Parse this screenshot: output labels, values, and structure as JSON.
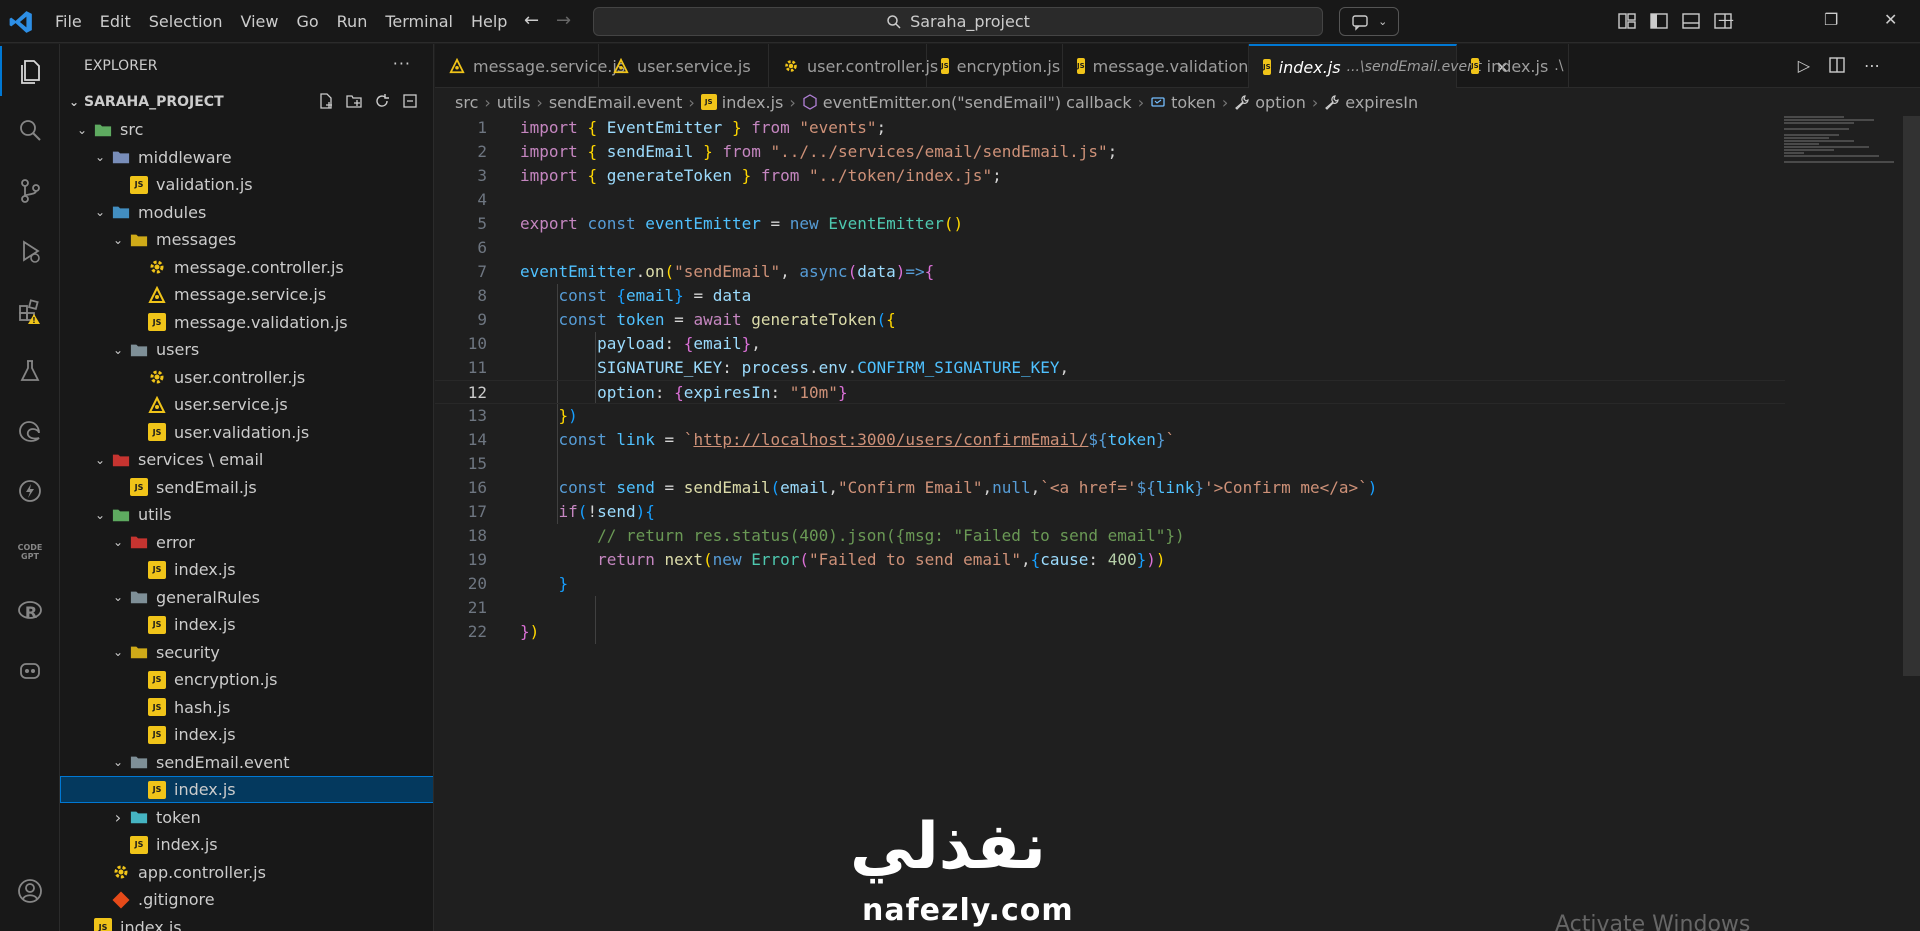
{
  "title_bar": {
    "menu": [
      "File",
      "Edit",
      "Selection",
      "View",
      "Go",
      "Run",
      "Terminal",
      "Help"
    ],
    "search_text": "Saraha_project"
  },
  "explorer": {
    "header": "EXPLORER",
    "more": "···",
    "project": "SARAHA_PROJECT",
    "tree": [
      {
        "label": "src",
        "depth": 0,
        "type": "folder",
        "open": true,
        "color": "#6bc46d"
      },
      {
        "label": "middleware",
        "depth": 1,
        "type": "folder",
        "open": true,
        "color": "#8aa2d6"
      },
      {
        "label": "validation.js",
        "depth": 2,
        "type": "js"
      },
      {
        "label": "modules",
        "depth": 1,
        "type": "folder",
        "open": true,
        "color": "#4aa3df"
      },
      {
        "label": "messages",
        "depth": 2,
        "type": "folder",
        "open": true,
        "color": "#f0c419"
      },
      {
        "label": "message.controller.js",
        "depth": 3,
        "type": "gear"
      },
      {
        "label": "message.service.js",
        "depth": 3,
        "type": "service"
      },
      {
        "label": "message.validation.js",
        "depth": 3,
        "type": "js"
      },
      {
        "label": "users",
        "depth": 2,
        "type": "folder",
        "open": true,
        "color": "#90a4ae"
      },
      {
        "label": "user.controller.js",
        "depth": 3,
        "type": "gear"
      },
      {
        "label": "user.service.js",
        "depth": 3,
        "type": "service"
      },
      {
        "label": "user.validation.js",
        "depth": 3,
        "type": "js"
      },
      {
        "label": "services \\ email",
        "depth": 1,
        "type": "folder",
        "open": true,
        "color": "#e53935"
      },
      {
        "label": "sendEmail.js",
        "depth": 2,
        "type": "js"
      },
      {
        "label": "utils",
        "depth": 1,
        "type": "folder",
        "open": true,
        "color": "#6bc46d"
      },
      {
        "label": "error",
        "depth": 2,
        "type": "folder",
        "open": true,
        "color": "#e53935"
      },
      {
        "label": "index.js",
        "depth": 3,
        "type": "js"
      },
      {
        "label": "generalRules",
        "depth": 2,
        "type": "folder",
        "open": true,
        "color": "#90a4ae"
      },
      {
        "label": "index.js",
        "depth": 3,
        "type": "js"
      },
      {
        "label": "security",
        "depth": 2,
        "type": "folder",
        "open": true,
        "color": "#f0c419"
      },
      {
        "label": "encryption.js",
        "depth": 3,
        "type": "js"
      },
      {
        "label": "hash.js",
        "depth": 3,
        "type": "js"
      },
      {
        "label": "index.js",
        "depth": 3,
        "type": "js"
      },
      {
        "label": "sendEmail.event",
        "depth": 2,
        "type": "folder",
        "open": true,
        "color": "#90a4ae"
      },
      {
        "label": "index.js",
        "depth": 3,
        "type": "js",
        "selected": true
      },
      {
        "label": "token",
        "depth": 2,
        "type": "folder",
        "open": false,
        "color": "#4dd0e1"
      },
      {
        "label": "index.js",
        "depth": 2,
        "type": "js"
      },
      {
        "label": "app.controller.js",
        "depth": 1,
        "type": "gear"
      },
      {
        "label": ".gitignore",
        "depth": 1,
        "type": "git"
      },
      {
        "label": "index.js",
        "depth": 0,
        "type": "js"
      }
    ]
  },
  "tabs": [
    {
      "label": "message.service.js",
      "icon": "service"
    },
    {
      "label": "user.service.js",
      "icon": "service"
    },
    {
      "label": "user.controller.js",
      "icon": "gear"
    },
    {
      "label": "encryption.js",
      "icon": "js"
    },
    {
      "label": "message.validation.js",
      "icon": "js"
    },
    {
      "label": "index.js",
      "desc": "...\\sendEmail.event",
      "icon": "js",
      "active": true
    },
    {
      "label": "index.js",
      "desc": ".\\",
      "icon": "js"
    }
  ],
  "breadcrumbs": [
    "src",
    "utils",
    "sendEmail.event",
    "index.js",
    "eventEmitter.on(\"sendEmail\") callback",
    "token",
    "option",
    "expiresIn"
  ],
  "editor": {
    "current_line": 12,
    "line_numbers": [
      "1",
      "2",
      "3",
      "4",
      "5",
      "6",
      "7",
      "8",
      "9",
      "10",
      "11",
      "12",
      "13",
      "14",
      "15",
      "16",
      "17",
      "18",
      "19",
      "20",
      "21",
      "22"
    ]
  },
  "watermark": {
    "arabic": "نفذلي",
    "latin": "nafezly.com"
  },
  "activate_windows": "Activate Windows"
}
